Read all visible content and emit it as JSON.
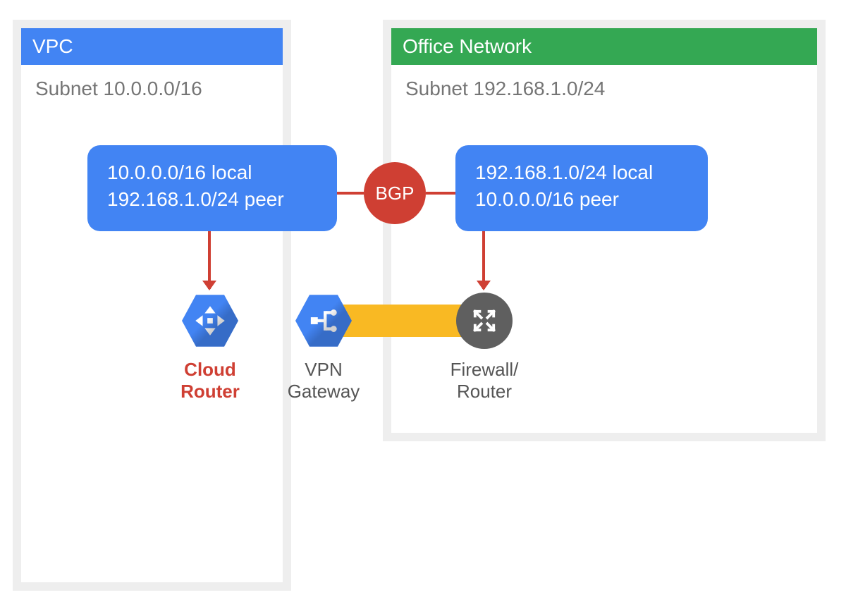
{
  "colors": {
    "blue": "#4284f3",
    "green": "#34a853",
    "red": "#cf3f33",
    "yellow": "#f9b923",
    "grey_bg": "#eeeeee",
    "grey_icon": "#5f5f5f",
    "text_muted": "#757575"
  },
  "vpc": {
    "title": "VPC",
    "subnet": "Subnet 10.0.0.0/16",
    "routes": {
      "local": "10.0.0.0/16 local",
      "peer": "192.168.1.0/24 peer"
    }
  },
  "office": {
    "title": "Office Network",
    "subnet": "Subnet 192.168.1.0/24",
    "routes": {
      "local": "192.168.1.0/24 local",
      "peer": "10.0.0.0/16 peer"
    }
  },
  "bgp_label": "BGP",
  "nodes": {
    "cloud_router": {
      "label_line1": "Cloud",
      "label_line2": "Router",
      "icon": "cloud-router-icon"
    },
    "vpn_gateway": {
      "label_line1": "VPN",
      "label_line2": "Gateway",
      "icon": "vpn-gateway-icon"
    },
    "firewall": {
      "label_line1": "Firewall/",
      "label_line2": "Router",
      "icon": "firewall-router-icon"
    }
  }
}
